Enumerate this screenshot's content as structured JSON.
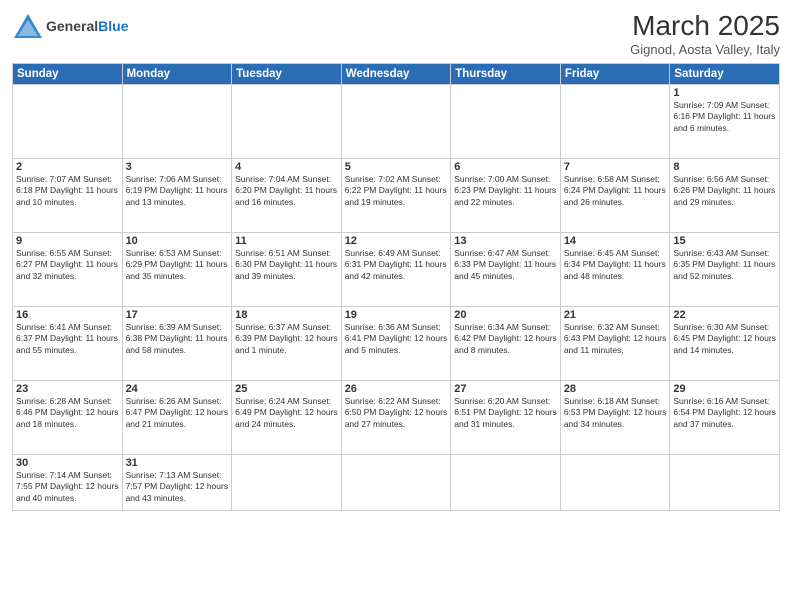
{
  "header": {
    "logo_general": "General",
    "logo_blue": "Blue",
    "title": "March 2025",
    "subtitle": "Gignod, Aosta Valley, Italy"
  },
  "days_of_week": [
    "Sunday",
    "Monday",
    "Tuesday",
    "Wednesday",
    "Thursday",
    "Friday",
    "Saturday"
  ],
  "weeks": [
    [
      {
        "day": "",
        "info": ""
      },
      {
        "day": "",
        "info": ""
      },
      {
        "day": "",
        "info": ""
      },
      {
        "day": "",
        "info": ""
      },
      {
        "day": "",
        "info": ""
      },
      {
        "day": "",
        "info": ""
      },
      {
        "day": "1",
        "info": "Sunrise: 7:09 AM\nSunset: 6:16 PM\nDaylight: 11 hours and 6 minutes."
      }
    ],
    [
      {
        "day": "2",
        "info": "Sunrise: 7:07 AM\nSunset: 6:18 PM\nDaylight: 11 hours and 10 minutes."
      },
      {
        "day": "3",
        "info": "Sunrise: 7:06 AM\nSunset: 6:19 PM\nDaylight: 11 hours and 13 minutes."
      },
      {
        "day": "4",
        "info": "Sunrise: 7:04 AM\nSunset: 6:20 PM\nDaylight: 11 hours and 16 minutes."
      },
      {
        "day": "5",
        "info": "Sunrise: 7:02 AM\nSunset: 6:22 PM\nDaylight: 11 hours and 19 minutes."
      },
      {
        "day": "6",
        "info": "Sunrise: 7:00 AM\nSunset: 6:23 PM\nDaylight: 11 hours and 22 minutes."
      },
      {
        "day": "7",
        "info": "Sunrise: 6:58 AM\nSunset: 6:24 PM\nDaylight: 11 hours and 26 minutes."
      },
      {
        "day": "8",
        "info": "Sunrise: 6:56 AM\nSunset: 6:26 PM\nDaylight: 11 hours and 29 minutes."
      }
    ],
    [
      {
        "day": "9",
        "info": "Sunrise: 6:55 AM\nSunset: 6:27 PM\nDaylight: 11 hours and 32 minutes."
      },
      {
        "day": "10",
        "info": "Sunrise: 6:53 AM\nSunset: 6:29 PM\nDaylight: 11 hours and 35 minutes."
      },
      {
        "day": "11",
        "info": "Sunrise: 6:51 AM\nSunset: 6:30 PM\nDaylight: 11 hours and 39 minutes."
      },
      {
        "day": "12",
        "info": "Sunrise: 6:49 AM\nSunset: 6:31 PM\nDaylight: 11 hours and 42 minutes."
      },
      {
        "day": "13",
        "info": "Sunrise: 6:47 AM\nSunset: 6:33 PM\nDaylight: 11 hours and 45 minutes."
      },
      {
        "day": "14",
        "info": "Sunrise: 6:45 AM\nSunset: 6:34 PM\nDaylight: 11 hours and 48 minutes."
      },
      {
        "day": "15",
        "info": "Sunrise: 6:43 AM\nSunset: 6:35 PM\nDaylight: 11 hours and 52 minutes."
      }
    ],
    [
      {
        "day": "16",
        "info": "Sunrise: 6:41 AM\nSunset: 6:37 PM\nDaylight: 11 hours and 55 minutes."
      },
      {
        "day": "17",
        "info": "Sunrise: 6:39 AM\nSunset: 6:38 PM\nDaylight: 11 hours and 58 minutes."
      },
      {
        "day": "18",
        "info": "Sunrise: 6:37 AM\nSunset: 6:39 PM\nDaylight: 12 hours and 1 minute."
      },
      {
        "day": "19",
        "info": "Sunrise: 6:36 AM\nSunset: 6:41 PM\nDaylight: 12 hours and 5 minutes."
      },
      {
        "day": "20",
        "info": "Sunrise: 6:34 AM\nSunset: 6:42 PM\nDaylight: 12 hours and 8 minutes."
      },
      {
        "day": "21",
        "info": "Sunrise: 6:32 AM\nSunset: 6:43 PM\nDaylight: 12 hours and 11 minutes."
      },
      {
        "day": "22",
        "info": "Sunrise: 6:30 AM\nSunset: 6:45 PM\nDaylight: 12 hours and 14 minutes."
      }
    ],
    [
      {
        "day": "23",
        "info": "Sunrise: 6:28 AM\nSunset: 6:46 PM\nDaylight: 12 hours and 18 minutes."
      },
      {
        "day": "24",
        "info": "Sunrise: 6:26 AM\nSunset: 6:47 PM\nDaylight: 12 hours and 21 minutes."
      },
      {
        "day": "25",
        "info": "Sunrise: 6:24 AM\nSunset: 6:49 PM\nDaylight: 12 hours and 24 minutes."
      },
      {
        "day": "26",
        "info": "Sunrise: 6:22 AM\nSunset: 6:50 PM\nDaylight: 12 hours and 27 minutes."
      },
      {
        "day": "27",
        "info": "Sunrise: 6:20 AM\nSunset: 6:51 PM\nDaylight: 12 hours and 31 minutes."
      },
      {
        "day": "28",
        "info": "Sunrise: 6:18 AM\nSunset: 6:53 PM\nDaylight: 12 hours and 34 minutes."
      },
      {
        "day": "29",
        "info": "Sunrise: 6:16 AM\nSunset: 6:54 PM\nDaylight: 12 hours and 37 minutes."
      }
    ],
    [
      {
        "day": "30",
        "info": "Sunrise: 7:14 AM\nSunset: 7:55 PM\nDaylight: 12 hours and 40 minutes."
      },
      {
        "day": "31",
        "info": "Sunrise: 7:13 AM\nSunset: 7:57 PM\nDaylight: 12 hours and 43 minutes."
      },
      {
        "day": "",
        "info": ""
      },
      {
        "day": "",
        "info": ""
      },
      {
        "day": "",
        "info": ""
      },
      {
        "day": "",
        "info": ""
      },
      {
        "day": "",
        "info": ""
      }
    ]
  ]
}
